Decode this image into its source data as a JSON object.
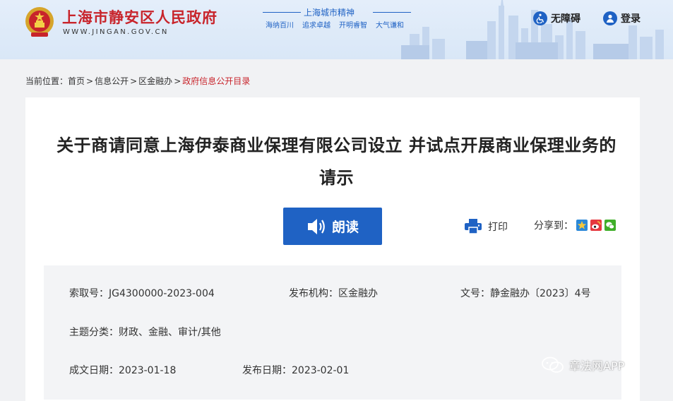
{
  "header": {
    "site_title": "上海市静安区人民政府",
    "site_url": "WWW.JINGAN.GOV.CN",
    "spirit_title": "上海城市精神",
    "spirit_items": [
      "海纳百川",
      "追求卓越",
      "开明睿智",
      "大气谦和"
    ],
    "accessibility_label": "无障碍",
    "login_label": "登录"
  },
  "breadcrumb": {
    "prefix": "当前位置：",
    "items": [
      "首页",
      "信息公开",
      "区金融办"
    ],
    "current": "政府信息公开目录",
    "separator": ">"
  },
  "document": {
    "title_line1": "关于商请同意上海伊泰商业保理有限公司设立 并试点开展商业保理业务的",
    "title_line2": "请示",
    "read_label": "朗读",
    "print_label": "打印",
    "share_label": "分享到："
  },
  "meta": {
    "index_label": "索取号：",
    "index_value": "JG4300000-2023-004",
    "org_label": "发布机构：",
    "org_value": "区金融办",
    "docno_label": "文号：",
    "docno_value": "静金融办〔2023〕4号",
    "topic_label": "主题分类：",
    "topic_value": "财政、金融、审计/其他",
    "written_label": "成文日期：",
    "written_value": "2023-01-18",
    "publish_label": "发布日期：",
    "publish_value": "2023-02-01"
  },
  "watermark": {
    "text": "章法网APP"
  },
  "colors": {
    "brand_red": "#c8242b",
    "brand_blue": "#1f62c4",
    "header_bg": "#dde9f8",
    "page_bg": "#f1f2f4"
  },
  "icons": {
    "emblem": "national-emblem-icon",
    "accessibility": "accessibility-icon",
    "login": "user-icon",
    "read": "speaker-icon",
    "print": "printer-icon",
    "share": [
      "qzone-icon",
      "weibo-icon",
      "wechat-icon"
    ],
    "watermark": "wechat-logo-icon"
  }
}
